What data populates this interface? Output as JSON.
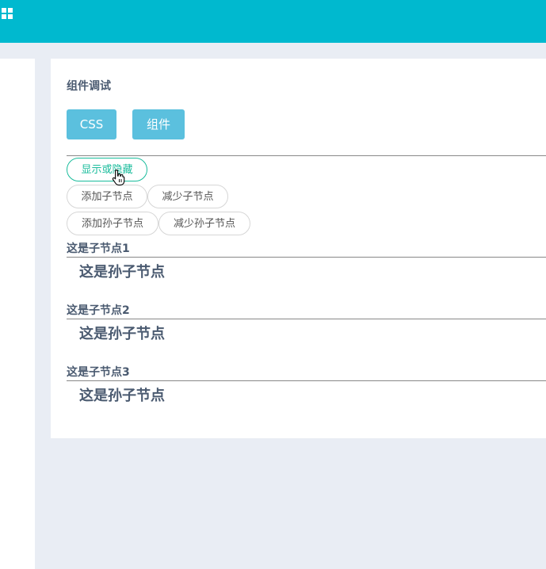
{
  "icons": {
    "menu": "grid-menu-icon",
    "cursor": "hand-pointer-icon"
  },
  "panel": {
    "title": "组件调试",
    "tabs": [
      {
        "label": "CSS"
      },
      {
        "label": "组件"
      }
    ]
  },
  "actions": {
    "toggle": "显示或隐藏",
    "add_child": "添加子节点",
    "remove_child": "减少子节点",
    "add_grandchild": "添加孙子节点",
    "remove_grandchild": "减少孙子节点"
  },
  "nodes": [
    {
      "child": "这是子节点1",
      "grandchild": "这是孙子节点"
    },
    {
      "child": "这是子节点2",
      "grandchild": "这是孙子节点"
    },
    {
      "child": "这是子节点3",
      "grandchild": "这是孙子节点"
    }
  ],
  "colors": {
    "topbar": "#00b9cf",
    "tab": "#5bc0de",
    "active": "#1abc9c"
  }
}
